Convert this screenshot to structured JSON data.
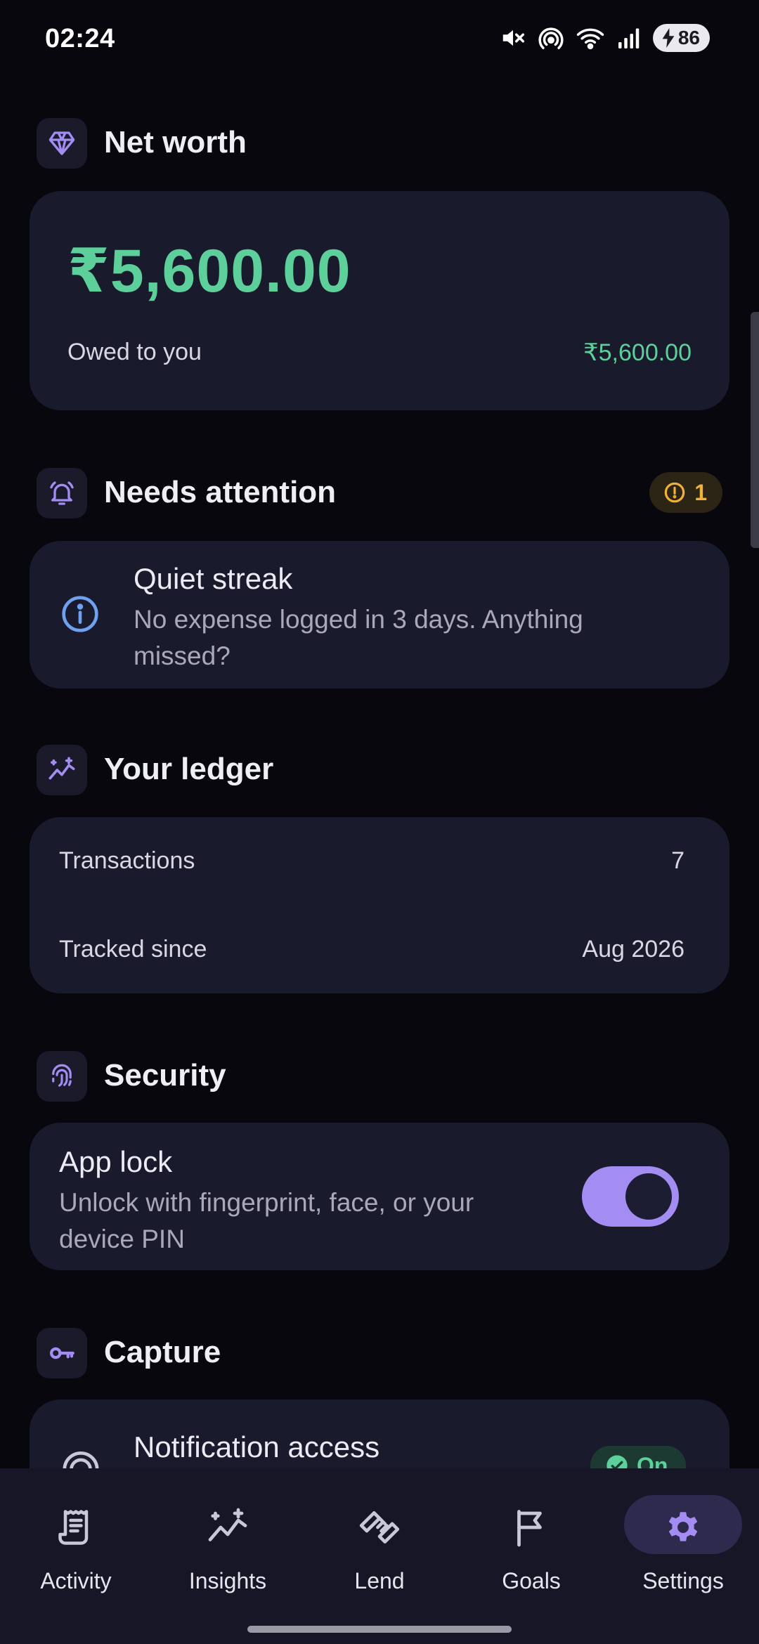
{
  "status_bar": {
    "time": "02:24",
    "battery": "86"
  },
  "net_worth": {
    "title": "Net worth",
    "amount": "₹5,600.00",
    "owed_label": "Owed to you",
    "owed_value": "₹5,600.00"
  },
  "attention": {
    "title": "Needs attention",
    "badge_count": "1",
    "item_title": "Quiet streak",
    "item_desc_line1": "No expense logged in 3 days. Anything",
    "item_desc_line2": "missed?"
  },
  "ledger": {
    "title": "Your ledger",
    "rows": [
      {
        "label": "Transactions",
        "value": "7"
      },
      {
        "label": "Tracked since",
        "value": "Aug 2026"
      }
    ]
  },
  "security": {
    "title": "Security",
    "app_lock_title": "App lock",
    "app_lock_desc_line1": "Unlock with fingerprint, face, or your",
    "app_lock_desc_line2": "device PIN",
    "app_lock_on": true
  },
  "capture": {
    "title": "Capture",
    "notification_title": "Notification access",
    "notification_status": "On"
  },
  "nav": [
    {
      "label": "Activity",
      "icon": "receipt-icon"
    },
    {
      "label": "Insights",
      "icon": "trend-sparkle-icon"
    },
    {
      "label": "Lend",
      "icon": "handshake-icon"
    },
    {
      "label": "Goals",
      "icon": "flag-icon"
    },
    {
      "label": "Settings",
      "icon": "gear-icon",
      "active": true
    }
  ],
  "colors": {
    "accent": "#a38cf2",
    "positive": "#5ccf9b",
    "warning": "#f0b13a",
    "info": "#6ea2f0",
    "card": "#191a2c",
    "background": "#07070d"
  }
}
